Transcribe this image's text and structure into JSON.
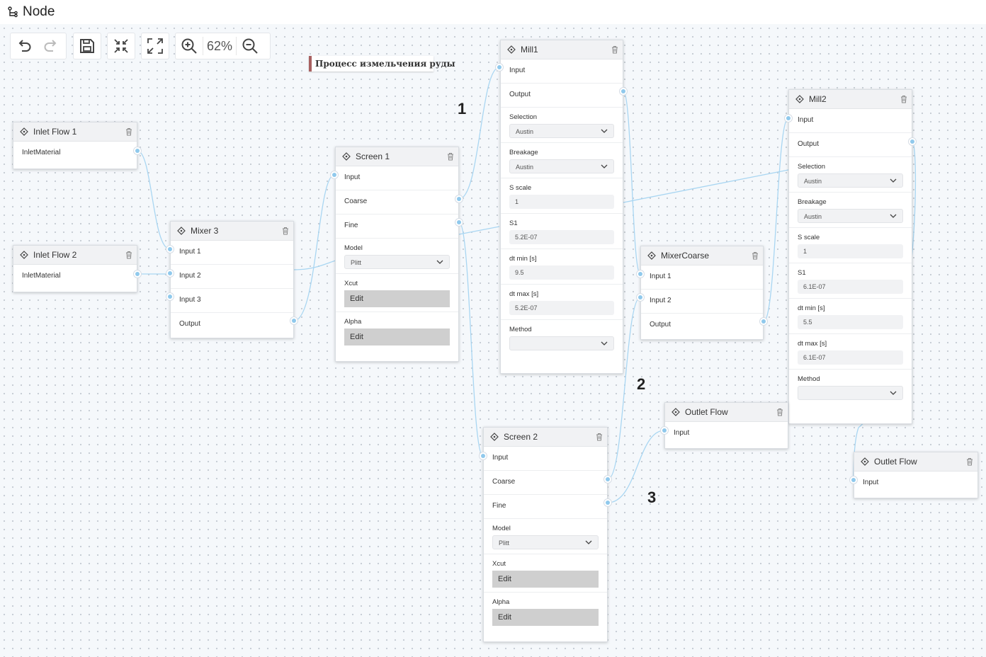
{
  "app": {
    "title": "Node"
  },
  "toolbar": {
    "zoom": "62%"
  },
  "annotation": "Процесс измельчения руды",
  "markers": [
    "1",
    "2",
    "3"
  ],
  "colors": {
    "edge": "#a9d6f2",
    "port": "#90c9ec",
    "annotation_accent": "#a86060"
  },
  "nodes": {
    "inlet1": {
      "title": "Inlet Flow 1",
      "ports": [
        "InletMaterial"
      ]
    },
    "inlet2": {
      "title": "Inlet Flow 2",
      "ports": [
        "InletMaterial"
      ]
    },
    "mixer3": {
      "title": "Mixer 3",
      "ports": [
        "Input 1",
        "Input 2",
        "Input 3",
        "Output"
      ]
    },
    "screen1": {
      "title": "Screen 1",
      "ports": [
        "Input",
        "Coarse",
        "Fine"
      ],
      "params": [
        {
          "label": "Model",
          "value": "Plitt"
        },
        {
          "label": "Xcut",
          "button": "Edit"
        },
        {
          "label": "Alpha",
          "button": "Edit"
        }
      ]
    },
    "mill1": {
      "title": "Mill1",
      "ports": [
        "Input",
        "Output"
      ],
      "params": [
        {
          "label": "Selection",
          "value": "Austin"
        },
        {
          "label": "Breakage",
          "value": "Austin"
        },
        {
          "label": "S scale",
          "value": "1"
        },
        {
          "label": "S1",
          "value": "5.2E-07"
        },
        {
          "label": "dt min [s]",
          "value": "9.5"
        },
        {
          "label": "dt max [s]",
          "value": "5.2E-07"
        },
        {
          "label": "Method",
          "value": ""
        }
      ]
    },
    "mixercoarse": {
      "title": "MixerCoarse",
      "ports": [
        "Input 1",
        "Input 2",
        "Output"
      ]
    },
    "mill2": {
      "title": "Mill2",
      "ports": [
        "Input",
        "Output"
      ],
      "params": [
        {
          "label": "Selection",
          "value": "Austin"
        },
        {
          "label": "Breakage",
          "value": "Austin"
        },
        {
          "label": "S scale",
          "value": "1"
        },
        {
          "label": "S1",
          "value": "6.1E-07"
        },
        {
          "label": "dt min [s]",
          "value": "5.5"
        },
        {
          "label": "dt max [s]",
          "value": "6.1E-07"
        },
        {
          "label": "Method",
          "value": ""
        }
      ]
    },
    "outlet1": {
      "title": "Outlet Flow",
      "ports": [
        "Input"
      ]
    },
    "screen2": {
      "title": "Screen 2",
      "ports": [
        "Input",
        "Coarse",
        "Fine"
      ],
      "params": [
        {
          "label": "Model",
          "value": "Plitt"
        },
        {
          "label": "Xcut",
          "button": "Edit"
        },
        {
          "label": "Alpha",
          "button": "Edit"
        }
      ]
    },
    "outlet2": {
      "title": "Outlet Flow",
      "ports": [
        "Input"
      ]
    }
  }
}
